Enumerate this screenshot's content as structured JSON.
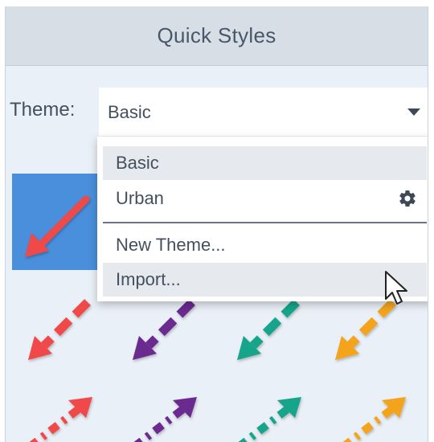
{
  "panel": {
    "title": "Quick Styles"
  },
  "theme": {
    "label": "Theme:",
    "selected": "Basic"
  },
  "menu": {
    "items": [
      {
        "label": "Basic",
        "highlighted": true
      },
      {
        "label": "Urban",
        "icon": "gear-icon"
      },
      {
        "label": "New Theme..."
      },
      {
        "label": "Import...",
        "highlighted": true
      }
    ]
  },
  "styles": {
    "selected_swatch_color": "#4a8fdc",
    "arrow_colors": [
      "#f04848",
      "#6a2a8f",
      "#15a58a",
      "#f3a41b"
    ],
    "rows": [
      "solid",
      "dashed",
      "dotted-dashed"
    ]
  },
  "cursor": {
    "icon": "mouse-pointer-icon"
  }
}
